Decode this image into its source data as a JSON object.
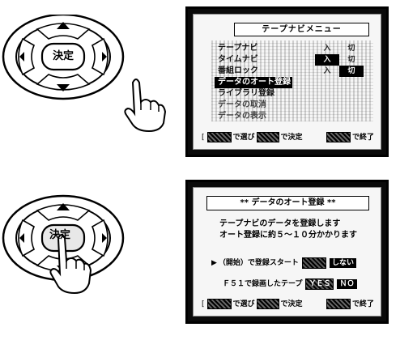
{
  "remote_top": {
    "center_button_label": "決定"
  },
  "remote_bottom": {
    "center_button_label": "決定"
  },
  "screen1": {
    "title": "テープナビメニュー",
    "menu_items": [
      "テープナビ",
      "タイムナビ",
      "番組ロック",
      "データのオート登録",
      "ライブラリ登録",
      "データの取消",
      "データの表示"
    ],
    "selected_index": 3,
    "on_off_rows": [
      {
        "on": "入",
        "off": "切",
        "on_selected": false
      },
      {
        "on": "入",
        "off": "切",
        "on_selected": true
      },
      {
        "on": "入",
        "off": "切",
        "on_selected": false
      }
    ],
    "footer": {
      "select_text": "で選び",
      "confirm_text": "で決定",
      "end_text": "で終了"
    }
  },
  "screen2": {
    "title": "** データのオート登録 **",
    "description_line1": "テープナビのデータを登録します",
    "description_line2": "オート登録に約５～１０分かかります",
    "option1": {
      "pointer": "▶",
      "label": "（開始）で登録スタート",
      "choice_selected": "",
      "choice_other": "しない"
    },
    "option2": {
      "label": "Ｆ５１で録画したテープ",
      "choice_selected": "ＹＥＳ",
      "choice_other": "ＮＯ"
    },
    "footer": {
      "select_text": "で選び",
      "confirm_text": "で決定",
      "end_text": "で終了"
    }
  }
}
